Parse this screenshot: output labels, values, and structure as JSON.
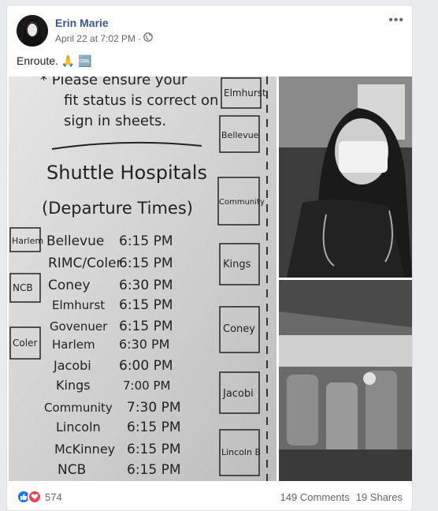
{
  "post": {
    "author": "Erin Marie",
    "timestamp": "April 22 at 7:02 PM",
    "separator": "·",
    "privacy_icon": "globe-icon",
    "more_label": "•••",
    "text": "Enroute. 🙏 🆒"
  },
  "whiteboard": {
    "note_line1": "* Please ensure your",
    "note_line2": "fit status is correct on",
    "note_line3": "sign in sheets.",
    "title": "Shuttle Hospitals",
    "subtitle": "(Departure Times)",
    "schedule": [
      {
        "name": "Bellevue",
        "time": "6:15 PM"
      },
      {
        "name": "RIMC/Coler",
        "time": "6:15 PM"
      },
      {
        "name": "Coney",
        "time": "6:30 PM"
      },
      {
        "name": "Elmhurst",
        "time": "6:15 PM"
      },
      {
        "name": "Govenuer",
        "time": "6:15 PM"
      },
      {
        "name": "Harlem",
        "time": "6:30 PM"
      },
      {
        "name": "Jacobi",
        "time": "6:00 PM"
      },
      {
        "name": "Kings",
        "time": "7:00 PM"
      },
      {
        "name": "Community",
        "time": "7:30 PM"
      },
      {
        "name": "Lincoln",
        "time": "6:15 PM"
      },
      {
        "name": "McKinney",
        "time": "6:15 PM"
      },
      {
        "name": "NCB",
        "time": "6:15 PM"
      }
    ],
    "left_tags": [
      "Harlem",
      "NCB",
      "Coler"
    ],
    "right_tags": [
      "Elmhurst",
      "Bellevue",
      "Community",
      "Kings",
      "Coney",
      "Jacobi",
      "Lincoln B"
    ]
  },
  "footer": {
    "reaction_count": "574",
    "comments": "149 Comments",
    "shares": "19 Shares"
  }
}
